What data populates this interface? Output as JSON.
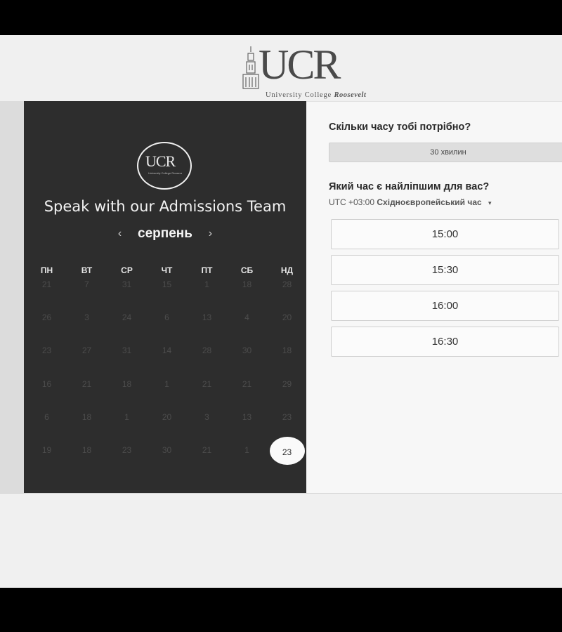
{
  "header": {
    "logo_letters": "UCR",
    "logo_subtitle": "University College",
    "logo_subtitle_script": "Roosevelt"
  },
  "left_panel": {
    "badge_text": "UCR",
    "badge_sub": "University College Roosevelt",
    "title": "Speak with our Admissions Team",
    "month": "серпень",
    "prev_icon": "chevron-left-icon",
    "next_icon": "chevron-right-icon",
    "prev_glyph": "‹",
    "next_glyph": "›",
    "weekdays": [
      "ПН",
      "ВТ",
      "СР",
      "ЧТ",
      "ПТ",
      "СБ",
      "НД"
    ],
    "weeks": [
      [
        "21",
        "7",
        "31",
        "15",
        "1",
        "18",
        "28"
      ],
      [
        "26",
        "3",
        "24",
        "6",
        "13",
        "4",
        "20"
      ],
      [
        "23",
        "27",
        "31",
        "14",
        "28",
        "30",
        "18"
      ],
      [
        "16",
        "21",
        "18",
        "1",
        "21",
        "21",
        "29"
      ],
      [
        "6",
        "18",
        "1",
        "20",
        "3",
        "13",
        "23"
      ],
      [
        "19",
        "18",
        "23",
        "30",
        "21",
        "1",
        "23"
      ]
    ],
    "selected_day": "23"
  },
  "right_panel": {
    "duration_question": "Скільки часу тобі потрібно?",
    "duration_value": "30 хвилин",
    "time_question": "Який час є найліпшим для вас?",
    "timezone_prefix": "UTC +03:00",
    "timezone_name": "Східноєвропейський час",
    "timezone_dropdown_glyph": "▾",
    "slots": [
      "15:00",
      "15:30",
      "16:00",
      "16:30"
    ]
  },
  "colors": {
    "left_panel_bg": "#2d2d2d",
    "right_panel_bg": "#f7f7f7",
    "page_bg": "#f0f0f0",
    "selected_day_bg": "#fafafa"
  }
}
